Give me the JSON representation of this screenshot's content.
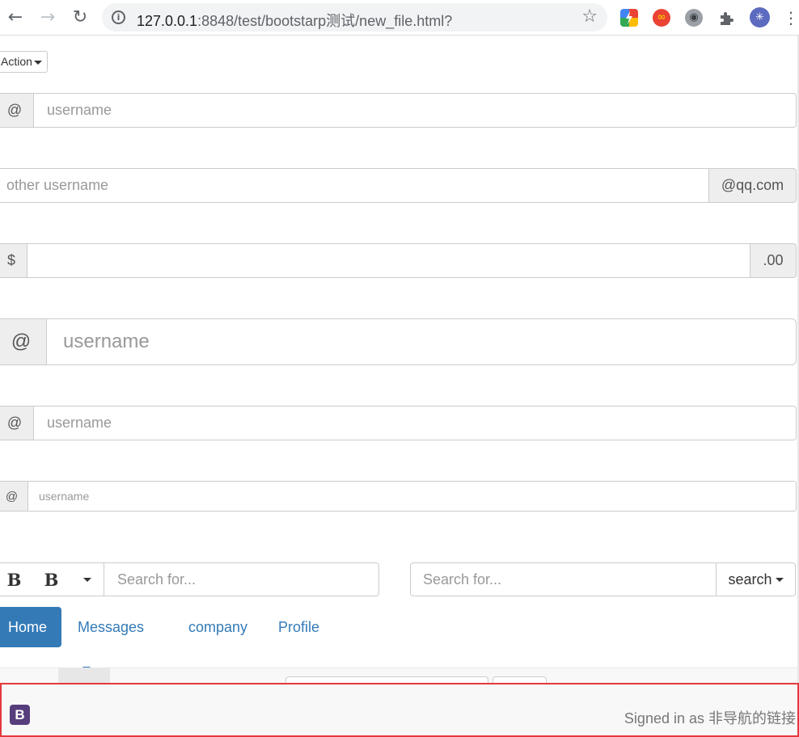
{
  "browser": {
    "url_host": "127.0.0.1",
    "url_rest": ":8848/test/bootstarp测试/new_file.html?",
    "back_glyph": "←",
    "forward_glyph": "→",
    "reload_glyph": "↻",
    "info_glyph": "i",
    "star_glyph": "☆",
    "menu_glyph": "⋮",
    "extensions": [
      {
        "name": "google-icon",
        "color": "#34a853",
        "glyph": ""
      },
      {
        "name": "infinity-icon",
        "color": "#ea4335",
        "glyph": "∞"
      },
      {
        "name": "robot-icon",
        "color": "#9aa0a6",
        "glyph": "◉"
      },
      {
        "name": "puzzle-icon",
        "color": "#5f6368",
        "glyph": ""
      },
      {
        "name": "profile-avatar",
        "color": "#5c6bc0",
        "glyph": "✳"
      }
    ]
  },
  "dropdown": {
    "label": "Action"
  },
  "input_groups": [
    {
      "prefix": "@",
      "placeholder": "username",
      "suffix": ""
    },
    {
      "prefix": "",
      "placeholder": "other username",
      "suffix": "@qq.com"
    },
    {
      "prefix": "$",
      "placeholder": "",
      "suffix": ".00"
    },
    {
      "prefix": "@",
      "placeholder": "username",
      "suffix": ""
    },
    {
      "prefix": "@",
      "placeholder": "username",
      "suffix": ""
    },
    {
      "prefix": "@",
      "placeholder": "username",
      "suffix": ""
    }
  ],
  "toolbar": {
    "bold1": "B",
    "bold2": "B",
    "search_placeholder_left": "Search for...",
    "search_placeholder_right": "Search for...",
    "search_button": "search"
  },
  "nav": {
    "home": "Home",
    "messages": "Messages",
    "company": "company",
    "profile": "Profile"
  },
  "bottom_navbar": {
    "brand": "B",
    "signed_text": "Signed in as 非导航的链接"
  },
  "colors": {
    "primary": "#337ab7",
    "highlight_border": "#e4393c",
    "brand": "#563d7c"
  }
}
